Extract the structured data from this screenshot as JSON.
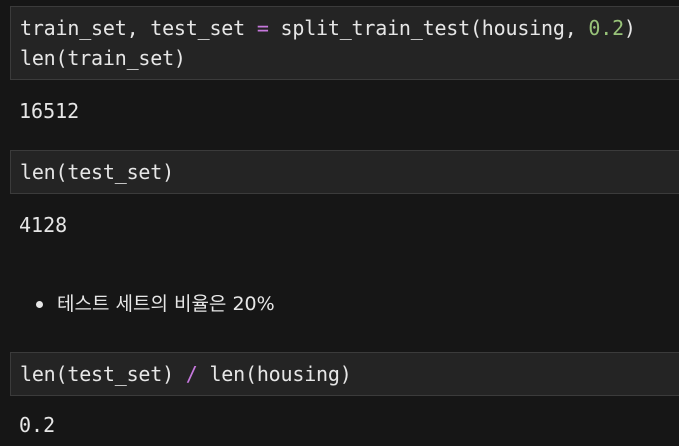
{
  "cells": [
    {
      "input_lines": [
        {
          "parts": [
            {
              "text": "train_set, test_set ",
              "kind": "plain"
            },
            {
              "text": "=",
              "kind": "op"
            },
            {
              "text": " split_train_test(housing, ",
              "kind": "plain"
            },
            {
              "text": "0.2",
              "kind": "num"
            },
            {
              "text": ")",
              "kind": "plain"
            }
          ]
        },
        {
          "parts": [
            {
              "text": "len(train_set)",
              "kind": "plain"
            }
          ]
        }
      ],
      "output": "16512"
    },
    {
      "input_lines": [
        {
          "parts": [
            {
              "text": "len(test_set)",
              "kind": "plain"
            }
          ]
        }
      ],
      "output": "4128"
    },
    {
      "markdown_bullet": "테스트 세트의 비율은 20%"
    },
    {
      "input_lines": [
        {
          "parts": [
            {
              "text": "len(test_set) ",
              "kind": "plain"
            },
            {
              "text": "/",
              "kind": "op"
            },
            {
              "text": " len(housing)",
              "kind": "plain"
            }
          ]
        }
      ],
      "output": "0.2"
    }
  ],
  "colors": {
    "background": "#161616",
    "cell_background": "#242424",
    "operator": "#c678dd",
    "number": "#98c379",
    "text": "#e6e6e6"
  }
}
